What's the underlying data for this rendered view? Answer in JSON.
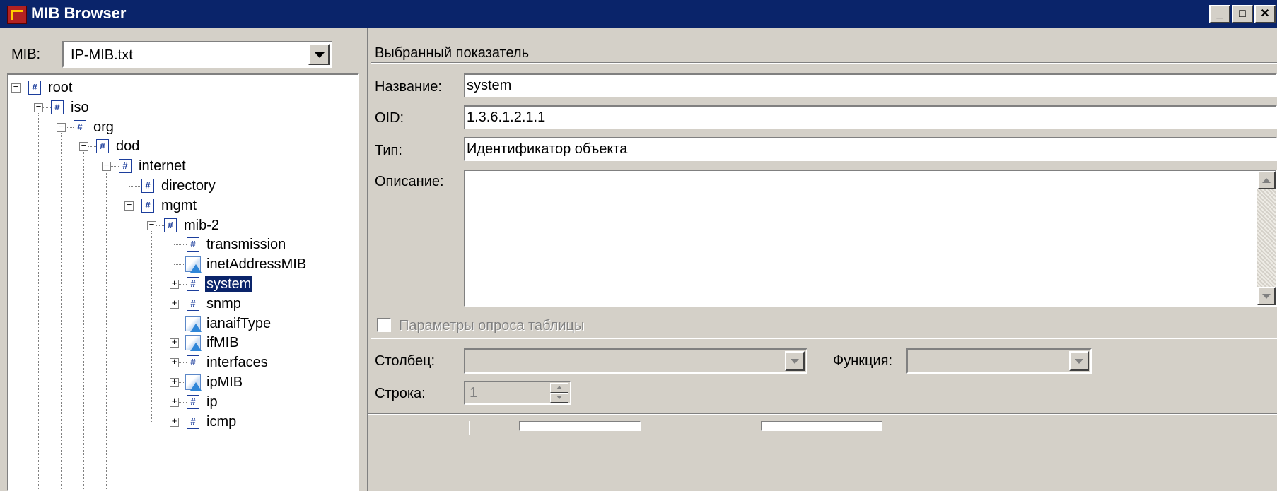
{
  "window": {
    "title": "MIB Browser"
  },
  "mib": {
    "label": "MIB:",
    "selected": "IP-MIB.txt"
  },
  "tree": {
    "nodes": [
      {
        "label": "root"
      },
      {
        "label": "iso"
      },
      {
        "label": "org"
      },
      {
        "label": "dod"
      },
      {
        "label": "internet"
      },
      {
        "label": "directory"
      },
      {
        "label": "mgmt"
      },
      {
        "label": "mib-2"
      },
      {
        "label": "transmission"
      },
      {
        "label": "inetAddressMIB"
      },
      {
        "label": "system",
        "selected": true
      },
      {
        "label": "snmp"
      },
      {
        "label": "ianaifType"
      },
      {
        "label": "ifMIB"
      },
      {
        "label": "interfaces"
      },
      {
        "label": "ipMIB"
      },
      {
        "label": "ip"
      },
      {
        "label": "icmp"
      }
    ]
  },
  "details": {
    "group_title": "Выбранный показатель",
    "name_label": "Название:",
    "name_value": "system",
    "oid_label": "OID:",
    "oid_value": "1.3.6.1.2.1.1",
    "type_label": "Тип:",
    "type_value": "Идентификатор объекта",
    "description_label": "Описание:",
    "description_value": ""
  },
  "table_polling": {
    "checkbox_label": "Параметры опроса таблицы",
    "column_label": "Столбец:",
    "column_value": "",
    "function_label": "Функция:",
    "function_value": "",
    "row_label": "Строка:",
    "row_value": "1"
  },
  "colors": {
    "titlebar": "#0a246a",
    "selection": "#0a246a",
    "face": "#d4d0c8"
  }
}
